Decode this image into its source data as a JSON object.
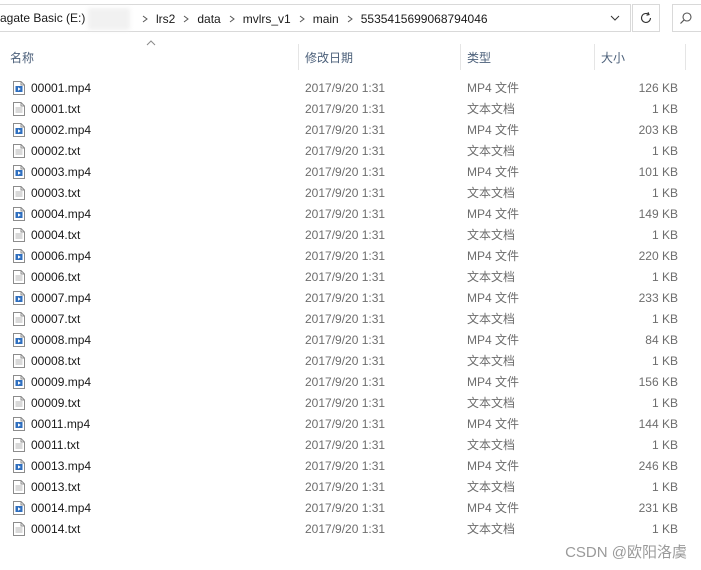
{
  "address_bar": {
    "drive_label": "agate Basic (E:)",
    "breadcrumbs": [
      "lrs2",
      "data",
      "mvlrs_v1",
      "main",
      "5535415699068794046"
    ]
  },
  "columns": {
    "name": "名称",
    "date": "修改日期",
    "type": "类型",
    "size": "大小"
  },
  "files": [
    {
      "name": "00001.mp4",
      "date": "2017/9/20 1:31",
      "type": "MP4 文件",
      "size": "126 KB",
      "icon": "video-file-icon"
    },
    {
      "name": "00001.txt",
      "date": "2017/9/20 1:31",
      "type": "文本文档",
      "size": "1 KB",
      "icon": "text-file-icon"
    },
    {
      "name": "00002.mp4",
      "date": "2017/9/20 1:31",
      "type": "MP4 文件",
      "size": "203 KB",
      "icon": "video-file-icon"
    },
    {
      "name": "00002.txt",
      "date": "2017/9/20 1:31",
      "type": "文本文档",
      "size": "1 KB",
      "icon": "text-file-icon"
    },
    {
      "name": "00003.mp4",
      "date": "2017/9/20 1:31",
      "type": "MP4 文件",
      "size": "101 KB",
      "icon": "video-file-icon"
    },
    {
      "name": "00003.txt",
      "date": "2017/9/20 1:31",
      "type": "文本文档",
      "size": "1 KB",
      "icon": "text-file-icon"
    },
    {
      "name": "00004.mp4",
      "date": "2017/9/20 1:31",
      "type": "MP4 文件",
      "size": "149 KB",
      "icon": "video-file-icon"
    },
    {
      "name": "00004.txt",
      "date": "2017/9/20 1:31",
      "type": "文本文档",
      "size": "1 KB",
      "icon": "text-file-icon"
    },
    {
      "name": "00006.mp4",
      "date": "2017/9/20 1:31",
      "type": "MP4 文件",
      "size": "220 KB",
      "icon": "video-file-icon"
    },
    {
      "name": "00006.txt",
      "date": "2017/9/20 1:31",
      "type": "文本文档",
      "size": "1 KB",
      "icon": "text-file-icon"
    },
    {
      "name": "00007.mp4",
      "date": "2017/9/20 1:31",
      "type": "MP4 文件",
      "size": "233 KB",
      "icon": "video-file-icon"
    },
    {
      "name": "00007.txt",
      "date": "2017/9/20 1:31",
      "type": "文本文档",
      "size": "1 KB",
      "icon": "text-file-icon"
    },
    {
      "name": "00008.mp4",
      "date": "2017/9/20 1:31",
      "type": "MP4 文件",
      "size": "84 KB",
      "icon": "video-file-icon"
    },
    {
      "name": "00008.txt",
      "date": "2017/9/20 1:31",
      "type": "文本文档",
      "size": "1 KB",
      "icon": "text-file-icon"
    },
    {
      "name": "00009.mp4",
      "date": "2017/9/20 1:31",
      "type": "MP4 文件",
      "size": "156 KB",
      "icon": "video-file-icon"
    },
    {
      "name": "00009.txt",
      "date": "2017/9/20 1:31",
      "type": "文本文档",
      "size": "1 KB",
      "icon": "text-file-icon"
    },
    {
      "name": "00011.mp4",
      "date": "2017/9/20 1:31",
      "type": "MP4 文件",
      "size": "144 KB",
      "icon": "video-file-icon"
    },
    {
      "name": "00011.txt",
      "date": "2017/9/20 1:31",
      "type": "文本文档",
      "size": "1 KB",
      "icon": "text-file-icon"
    },
    {
      "name": "00013.mp4",
      "date": "2017/9/20 1:31",
      "type": "MP4 文件",
      "size": "246 KB",
      "icon": "video-file-icon"
    },
    {
      "name": "00013.txt",
      "date": "2017/9/20 1:31",
      "type": "文本文档",
      "size": "1 KB",
      "icon": "text-file-icon"
    },
    {
      "name": "00014.mp4",
      "date": "2017/9/20 1:31",
      "type": "MP4 文件",
      "size": "231 KB",
      "icon": "video-file-icon"
    },
    {
      "name": "00014.txt",
      "date": "2017/9/20 1:31",
      "type": "文本文档",
      "size": "1 KB",
      "icon": "text-file-icon"
    }
  ],
  "watermark": "CSDN @欧阳洛虞",
  "colors": {
    "header_text": "#4c607a",
    "secondary_text": "#6d6d6d",
    "border": "#d9d9d9",
    "video_icon_accent": "#2f6fbf"
  }
}
